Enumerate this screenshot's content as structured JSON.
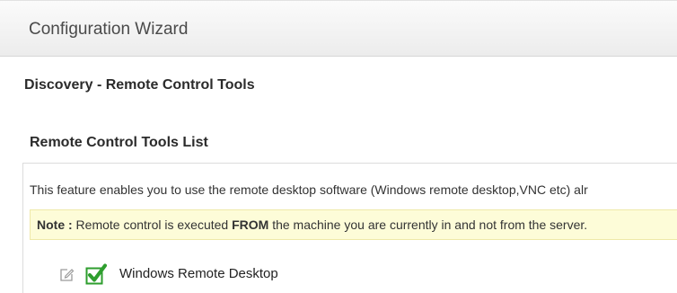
{
  "header": {
    "title": "Configuration Wizard"
  },
  "page": {
    "section_title": "Discovery - Remote Control Tools"
  },
  "tools_list": {
    "title": "Remote Control Tools List",
    "description": "This feature enables you to use the remote desktop software (Windows remote desktop,VNC etc) alr",
    "note": {
      "label": "Note :",
      "text_before": " Remote control is executed ",
      "emphasis": "FROM",
      "text_after": " the machine you are currently in and not from the server."
    },
    "items": [
      {
        "name": "Windows Remote Desktop",
        "enabled": true,
        "icon": "edit-icon"
      }
    ]
  },
  "colors": {
    "check_green": "#2e9e2e",
    "note_background": "#fdfcd8"
  }
}
